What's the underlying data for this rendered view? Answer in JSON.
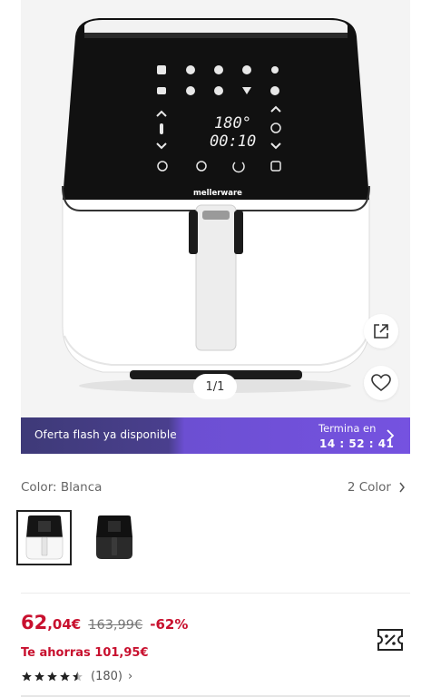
{
  "gallery": {
    "brand_text": "mellerware",
    "display_temp": "180°",
    "display_time": "00:10",
    "counter": "1/1"
  },
  "flash_banner": {
    "text": "Oferta flash ya disponible",
    "ends_label": "Termina en",
    "timer": "14 : 52 : 41"
  },
  "color": {
    "label": "Color: Blanca",
    "count": "2 Color",
    "options": [
      "white-fryer",
      "black-fryer"
    ]
  },
  "price": {
    "integer": "62",
    "decimal": ",04€",
    "original": "163,99€",
    "discount": "-62%",
    "savings": "Te ahorras 101,95€"
  },
  "rating": {
    "stars": 4.5,
    "count": "(180)",
    "arrow": "›"
  },
  "colors": {
    "accent_red": "#c8102e",
    "banner_purple": "#7552e0",
    "banner_dark": "#3e3a78"
  }
}
